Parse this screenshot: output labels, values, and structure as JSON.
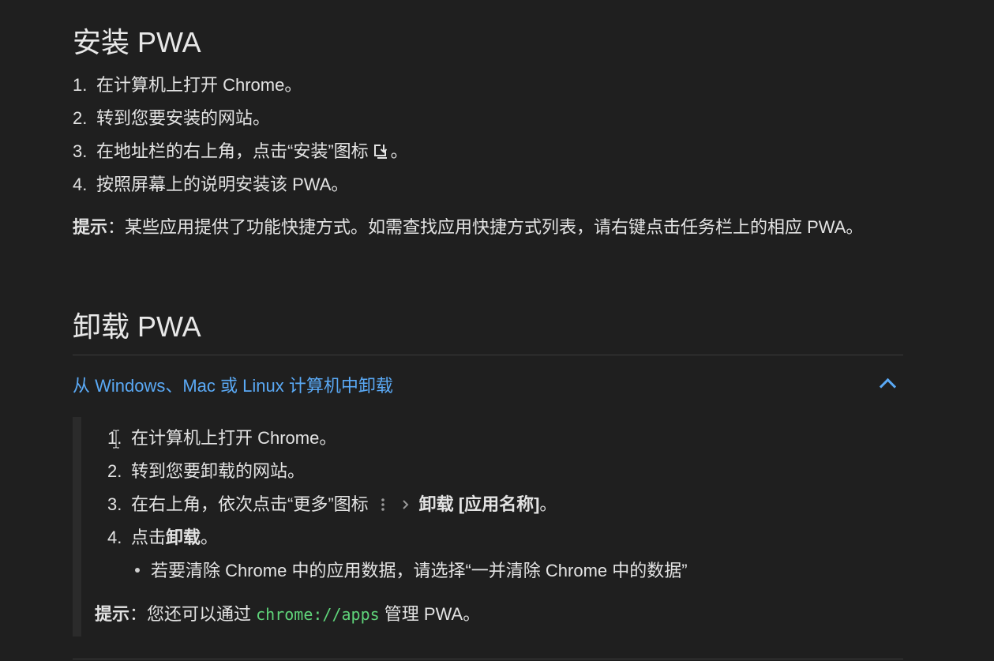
{
  "install": {
    "title": "安装 PWA",
    "steps": [
      {
        "num": "1.",
        "text": "在计算机上打开 Chrome。"
      },
      {
        "num": "2.",
        "text": "转到您要安装的网站。"
      },
      {
        "num": "3.",
        "text_before": "在地址栏的右上角，点击“安装”图标",
        "text_after": "。"
      },
      {
        "num": "4.",
        "text": "按照屏幕上的说明安装该 PWA。"
      }
    ],
    "tip_label": "提示",
    "tip_text": "：某些应用提供了功能快捷方式。如需查找应用快捷方式列表，请右键点击任务栏上的相应 PWA。"
  },
  "uninstall": {
    "title": "卸载 PWA",
    "expander_title": "从 Windows、Mac 或 Linux 计算机中卸载",
    "steps": [
      {
        "num": "1.",
        "text": "在计算机上打开 Chrome。"
      },
      {
        "num": "2.",
        "text": "转到您要卸载的网站。"
      },
      {
        "num": "3.",
        "text_before": "在右上角，依次点击“更多”图标",
        "bold": "卸载 [应用名称]",
        "text_after": "。"
      },
      {
        "num": "4.",
        "text_before": "点击",
        "bold": "卸载",
        "text_after": "。"
      }
    ],
    "sub_bullet": "若要清除 Chrome 中的应用数据，请选择“一并清除 Chrome 中的数据”",
    "tip_label": "提示",
    "tip_before": "：您还可以通过 ",
    "tip_code": "chrome://apps",
    "tip_after": " 管理 PWA。"
  },
  "colors": {
    "background": "#1f1f1f",
    "text": "#e3e3e3",
    "link": "#5aa9f5",
    "code": "#5fd47a"
  }
}
